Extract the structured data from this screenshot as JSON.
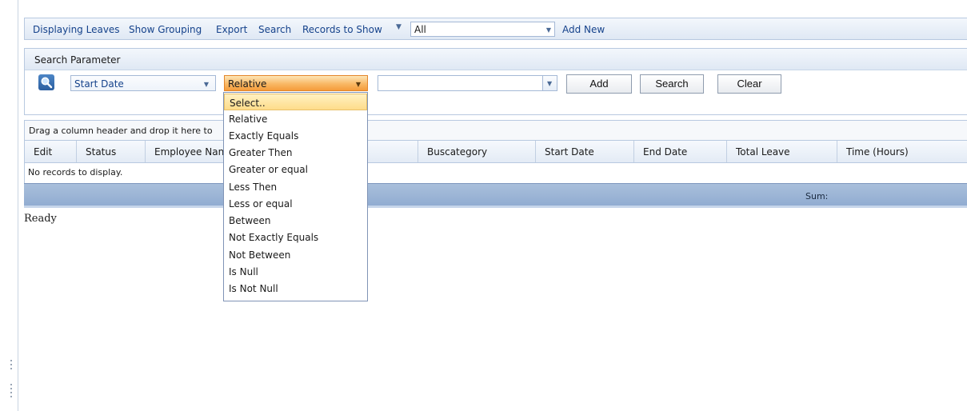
{
  "toolbar": {
    "items": [
      "Displaying Leaves",
      "Show Grouping",
      "Export",
      "Search",
      "Records to Show"
    ],
    "records_select_value": "All",
    "add_new": "Add New"
  },
  "search_panel": {
    "title": "Search Parameter",
    "field_value": "Start Date",
    "operator_value": "Relative",
    "value_input": "",
    "add_label": "Add",
    "search_label": "Search",
    "clear_label": "Clear"
  },
  "grid": {
    "group_hint": "Drag a column header and drop it here to",
    "columns": [
      "Edit",
      "Status",
      "Employee Nan",
      "",
      "Buscategory",
      "Start Date",
      "End Date",
      "Total Leave",
      "Time (Hours)"
    ],
    "empty_text": "No records to display.",
    "footer_sum": "Sum:"
  },
  "status_text": "Ready",
  "operator_dropdown": {
    "options": [
      "Select..",
      "Relative",
      "Exactly Equals",
      "Greater Then",
      "Greater or equal",
      "Less Then",
      "Less or equal",
      "Between",
      "Not Exactly Equals",
      "Not Between",
      "Is Null",
      "Is Not Null"
    ],
    "highlighted": "Select.."
  },
  "colors": {
    "toolbar_link": "#15428b",
    "active_combo": "#f9b865",
    "footer": "#9db5d6"
  }
}
